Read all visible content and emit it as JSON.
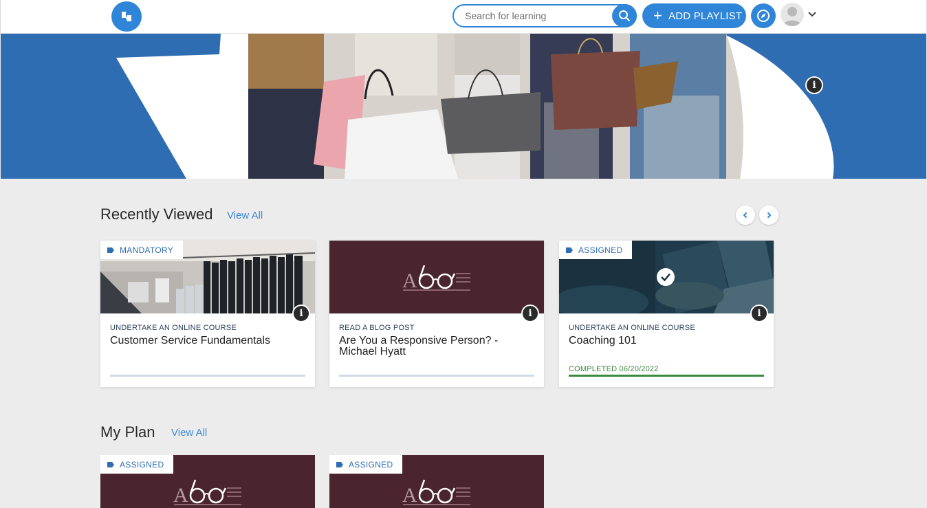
{
  "header": {
    "search_placeholder": "Search for learning",
    "add_playlist_label": "ADD PLAYLIST",
    "add_playlist_plus": "+"
  },
  "hero": {
    "info_glyph": "i"
  },
  "recently_viewed": {
    "title": "Recently Viewed",
    "view_all": "View All",
    "cards": [
      {
        "tag": "MANDATORY",
        "type": "UNDERTAKE AN ONLINE COURSE",
        "title": "Customer Service Fundamentals",
        "image": "clothing-rack",
        "progress": 0
      },
      {
        "tag": "",
        "type": "READ A BLOG POST",
        "title": "Are You a Responsive Person? - Michael Hyatt",
        "image": "reading-glasses-logo",
        "progress": 0
      },
      {
        "tag": "ASSIGNED",
        "type": "UNDERTAKE AN ONLINE COURSE",
        "title": "Coaching 101",
        "image": "laptop-checkmark",
        "status": "COMPLETED 06/20/2022",
        "progress": 1
      }
    ]
  },
  "my_plan": {
    "title": "My Plan",
    "view_all": "View All",
    "cards": [
      {
        "tag": "ASSIGNED",
        "image": "reading-glasses-logo"
      },
      {
        "tag": "ASSIGNED",
        "image": "reading-glasses-logo"
      }
    ]
  },
  "icons": {
    "logo": "brand-logo-icon",
    "search": "search-icon",
    "compass": "compass-icon",
    "avatar": "user-avatar-icon",
    "caret": "chevron-down-icon",
    "info": "info-icon",
    "tag": "tag-icon",
    "prev": "chevron-left-icon",
    "next": "chevron-right-icon",
    "check": "checkmark-icon"
  },
  "colors": {
    "brand_blue": "#2f86d8",
    "hero_blue": "#2f6db3",
    "maroon": "#4a2530",
    "progress_green": "#3a8a3e",
    "background": "#ececec"
  }
}
